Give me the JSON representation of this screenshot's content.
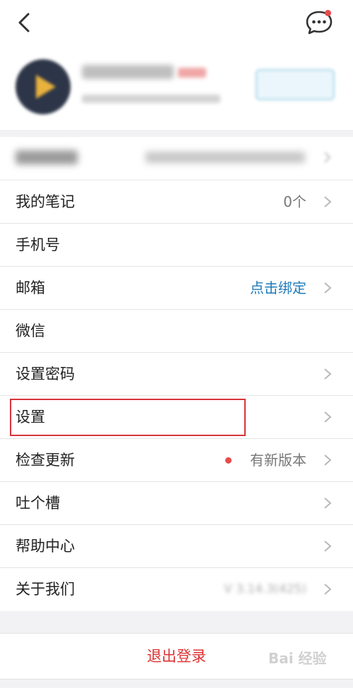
{
  "header": {
    "back_icon": "chevron-left-icon",
    "message_icon": "chat-bubble-icon",
    "badge_color": "#e84b4b"
  },
  "menu": [
    {
      "label": "我的笔记",
      "value": "0个"
    },
    {
      "label": "手机号"
    },
    {
      "label": "邮箱",
      "value": "点击绑定",
      "value_color": "#1f7bb8"
    },
    {
      "label": "微信"
    },
    {
      "label": "设置密码"
    },
    {
      "label": "设置",
      "highlighted": true,
      "highlight_color": "#d9343d"
    },
    {
      "label": "检查更新",
      "value": "有新版本",
      "dot_color": "#e84b4b"
    },
    {
      "label": "吐个槽"
    },
    {
      "label": "帮助中心"
    },
    {
      "label": "关于我们",
      "value": "V 3.14.3(425)"
    }
  ],
  "logout": {
    "label": "退出登录",
    "color": "#d33"
  },
  "watermark": "Bai 经验"
}
